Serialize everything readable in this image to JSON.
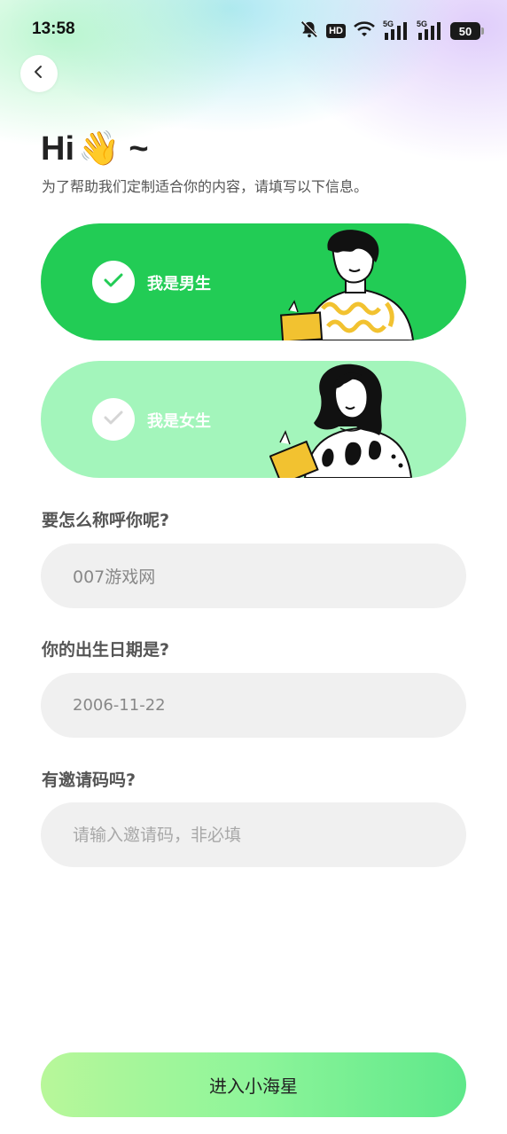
{
  "status_bar": {
    "time": "13:58",
    "hd_label": "HD",
    "signal_1": "5G",
    "signal_2": "5G",
    "battery": "50",
    "icons": [
      "bell-muted-icon",
      "hd-icon",
      "wifi-icon",
      "cell-signal-icon",
      "cell-signal-icon",
      "battery-icon"
    ]
  },
  "header": {
    "back_icon": "chevron-left-icon",
    "greeting": "Hi",
    "greeting_emoji": "👋",
    "greeting_suffix": "~",
    "subtitle": "为了帮助我们定制适合你的内容，请填写以下信息。"
  },
  "gender_options": [
    {
      "label": "我是男生",
      "selected": true,
      "color": "#22cc55"
    },
    {
      "label": "我是女生",
      "selected": false,
      "color": "#a3f5bb"
    }
  ],
  "form": {
    "nickname": {
      "label": "要怎么称呼你呢?",
      "value": "007游戏网"
    },
    "birthday": {
      "label": "你的出生日期是?",
      "value": "2006-11-22"
    },
    "invite": {
      "label": "有邀请码吗?",
      "value": "",
      "placeholder": "请输入邀请码，非必填"
    }
  },
  "submit": {
    "label": "进入小海星"
  }
}
